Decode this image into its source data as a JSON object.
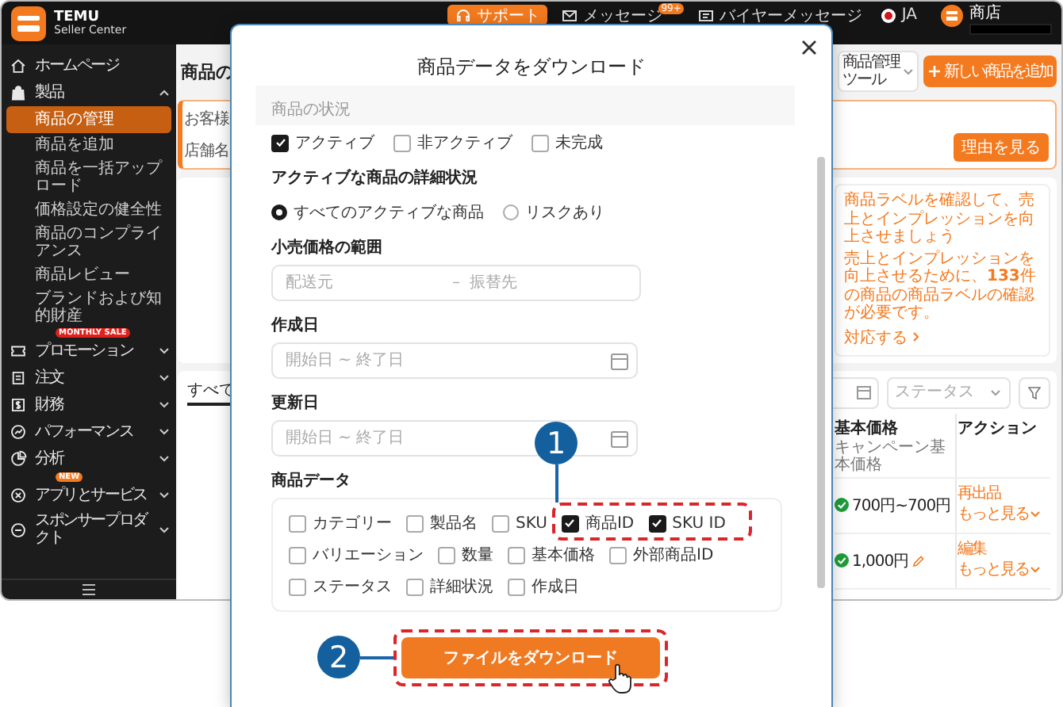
{
  "top_bar": {
    "brand": {
      "name": "TEMU",
      "subtitle": "Seller Center"
    },
    "items": [
      {
        "kind": "support",
        "label": "サポート"
      },
      {
        "kind": "messages",
        "label": "メッセージ",
        "badge": "99+"
      },
      {
        "kind": "buyer_messages",
        "label": "バイヤーメッセージ"
      },
      {
        "kind": "language",
        "label": "JA"
      }
    ],
    "store": {
      "label": "商店"
    }
  },
  "sidebar": {
    "items": [
      {
        "label": "ホームページ"
      },
      {
        "label": "製品",
        "expanded": true,
        "children": [
          {
            "label": "商品の管理",
            "selected": true
          },
          {
            "label": "商品を追加",
            "selected": false
          },
          {
            "label": "商品を一括アップロード",
            "selected": false
          },
          {
            "label": "価格設定の健全性",
            "selected": false
          },
          {
            "label": "商品のコンプライアンス",
            "selected": false
          },
          {
            "label": "商品レビュー",
            "selected": false
          },
          {
            "label": "ブランドおよび知的財産",
            "selected": false
          }
        ]
      },
      {
        "label": "プロモーション",
        "expanded": false,
        "badge": {
          "label": "MONTHLY SALE",
          "color": "#e0201b"
        }
      },
      {
        "label": "注文",
        "expanded": false
      },
      {
        "label": "財務",
        "expanded": false
      },
      {
        "label": "パフォーマンス",
        "expanded": false
      },
      {
        "label": "分析",
        "expanded": false
      },
      {
        "label": "アプリとサービス",
        "expanded": false,
        "badge": {
          "label": "NEW",
          "color": "#f47a1f"
        }
      },
      {
        "label": "スポンサープロダクト",
        "expanded": false
      }
    ]
  },
  "page": {
    "title": "商品の",
    "tools_dropdown": "商品管理ツール",
    "add_button": "新しい商品を追加",
    "notices": [
      "お客様",
      "店舗名"
    ],
    "notice_button": "理由を見る",
    "label_card": {
      "title": "商品ラベルを確認して、売上とインプレッションを向上させましょう",
      "body": "売上とインプレッションを向上させるために、**133**件の商品の商品ラベルの確認が必要です。",
      "link": "対応する"
    },
    "tab": "すべて",
    "status_filter": {
      "placeholder": "ステータス"
    },
    "table": {
      "columns": [
        {
          "label": "基本価格",
          "sublabel": "キャンペーン基本価格"
        },
        {
          "label": "アクション"
        }
      ],
      "rows": [
        {
          "price": "700円~700円",
          "editable": false,
          "actions": [
            "再出品",
            "もっと見る"
          ]
        },
        {
          "price": "1,000円",
          "editable": true,
          "actions": [
            "編集",
            "もっと見る"
          ]
        }
      ]
    }
  },
  "modal": {
    "title": "商品データをダウンロード",
    "status": {
      "label": "商品の状況",
      "options": [
        {
          "label": "アクティブ",
          "checked": true
        },
        {
          "label": "非アクティブ",
          "checked": false
        },
        {
          "label": "未完成",
          "checked": false
        }
      ]
    },
    "detail_status": {
      "label": "アクティブな商品の詳細状況",
      "options": [
        {
          "label": "すべてのアクティブな商品",
          "selected": true
        },
        {
          "label": "リスクあり",
          "selected": false
        }
      ]
    },
    "price_range": {
      "label": "小売価格の範囲",
      "from_placeholder": "配送元",
      "separator": "–",
      "to_placeholder": "振替先"
    },
    "created": {
      "label": "作成日",
      "placeholder": "開始日 ~ 終了日"
    },
    "updated": {
      "label": "更新日",
      "placeholder": "開始日 ~ 終了日"
    },
    "product_data": {
      "label": "商品データ",
      "options": [
        {
          "label": "カテゴリー",
          "checked": false
        },
        {
          "label": "製品名",
          "checked": false
        },
        {
          "label": "SKU",
          "checked": false
        },
        {
          "label": "商品ID",
          "checked": true
        },
        {
          "label": "SKU ID",
          "checked": true
        },
        {
          "label": "バリエーション",
          "checked": false
        },
        {
          "label": "数量",
          "checked": false
        },
        {
          "label": "基本価格",
          "checked": false
        },
        {
          "label": "外部商品ID",
          "checked": false
        },
        {
          "label": "ステータス",
          "checked": false
        },
        {
          "label": "詳細状況",
          "checked": false
        },
        {
          "label": "作成日",
          "checked": false
        }
      ]
    },
    "download_button": "ファイルをダウンロード"
  },
  "callouts": [
    {
      "number": "1"
    },
    {
      "number": "2"
    }
  ]
}
